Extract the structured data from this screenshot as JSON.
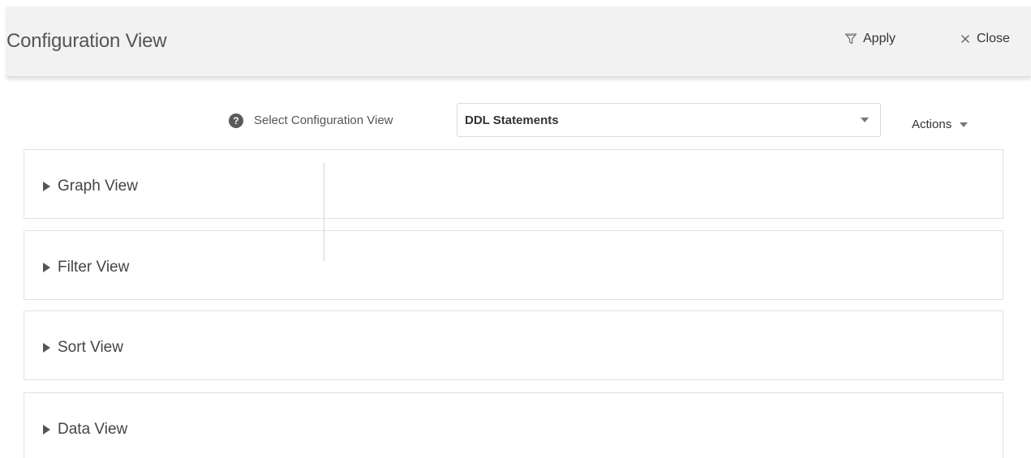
{
  "header": {
    "title": "Configuration View",
    "apply_label": "Apply",
    "close_label": "Close",
    "apply_icon": "funnel-icon",
    "close_icon": "close-icon"
  },
  "selector": {
    "help_icon": "?",
    "label": "Select Configuration View",
    "selected_value": "DDL Statements",
    "actions_label": "Actions"
  },
  "panels": [
    {
      "label": "Graph View",
      "expanded": false
    },
    {
      "label": "Filter View",
      "expanded": false
    },
    {
      "label": "Sort View",
      "expanded": false
    },
    {
      "label": "Data View",
      "expanded": false
    }
  ],
  "colors": {
    "header_bg": "#f2f2f2",
    "panel_border": "#dde3ea",
    "help_icon_bg": "#5a5a5a"
  }
}
